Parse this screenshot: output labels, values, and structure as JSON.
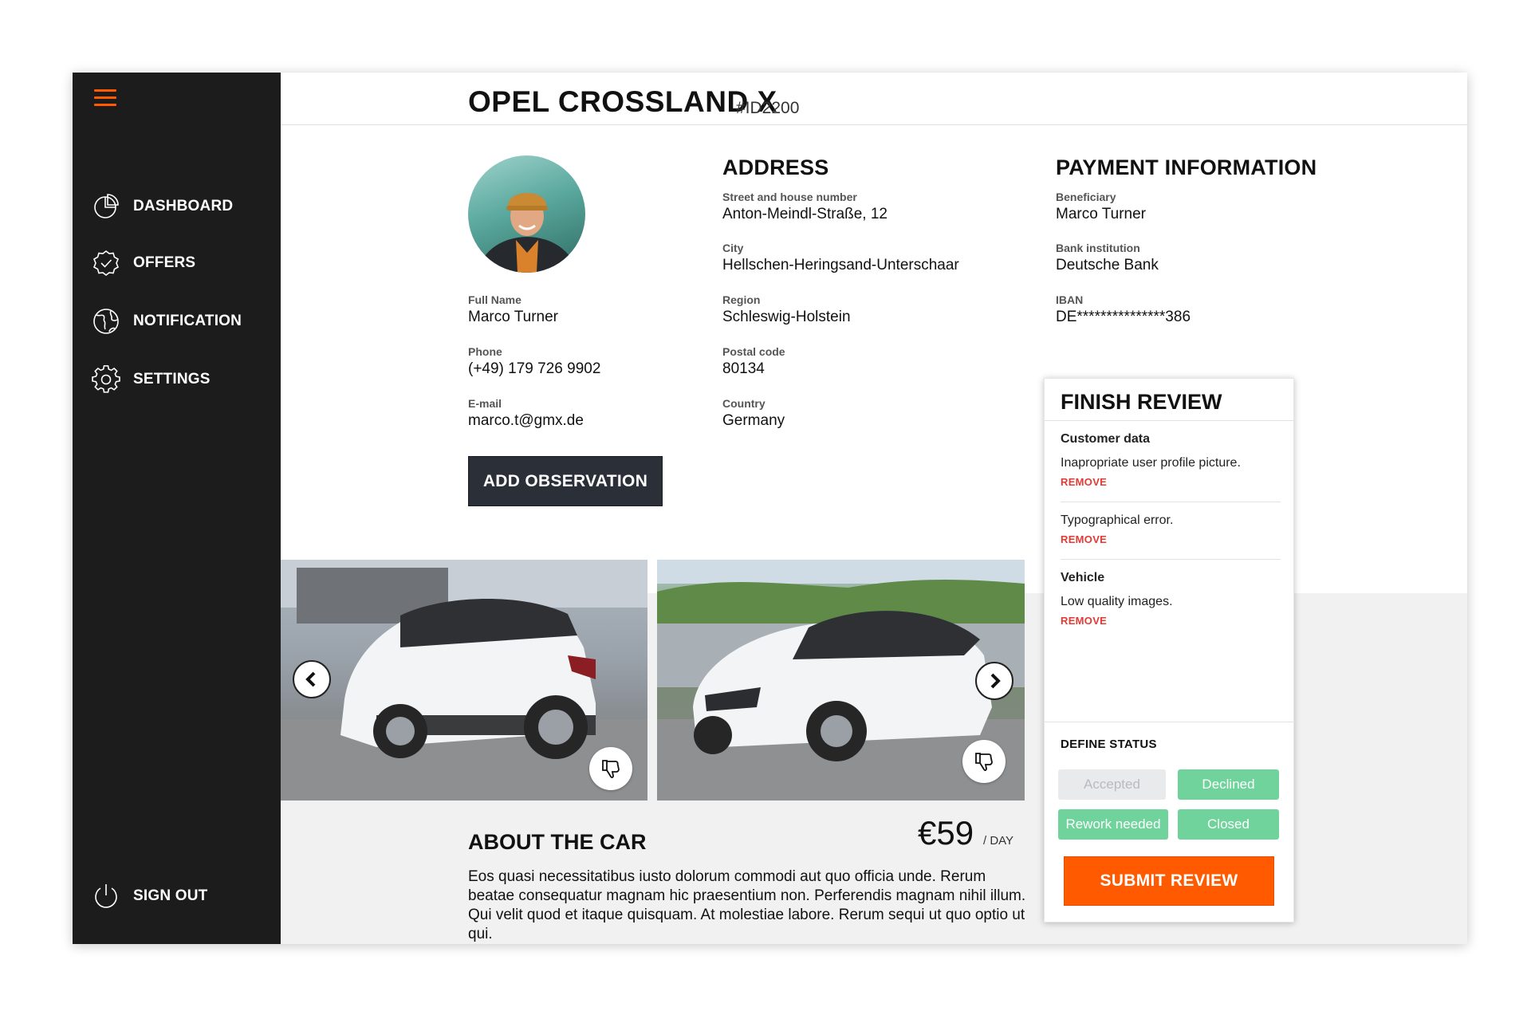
{
  "colors": {
    "accent": "#ff5a00",
    "sidebar_bg": "#1c1c1c",
    "status_green": "#6fd39b",
    "status_disabled": "#e9eaec",
    "remove_red": "#e53935",
    "dark_button": "#2b2f38"
  },
  "sidebar": {
    "menu_icon": "hamburger-icon",
    "items": [
      {
        "label": "DASHBOARD",
        "icon": "pie-chart-icon"
      },
      {
        "label": "OFFERS",
        "icon": "badge-check-icon"
      },
      {
        "label": "NOTIFICATION",
        "icon": "globe-icon"
      },
      {
        "label": "SETTINGS",
        "icon": "gear-icon"
      }
    ],
    "sign_out": {
      "label": "SIGN OUT",
      "icon": "power-icon"
    }
  },
  "header": {
    "title": "OPEL CROSSLAND X",
    "id": "#ID2200"
  },
  "profile": {
    "full_name_label": "Full Name",
    "full_name": "Marco Turner",
    "phone_label": "Phone",
    "phone": "(+49) 179 726 9902",
    "email_label": "E-mail",
    "email": "marco.t@gmx.de",
    "add_observation": "ADD OBSERVATION"
  },
  "address": {
    "heading": "ADDRESS",
    "street_label": "Street and house number",
    "street": "Anton-Meindl-Straße, 12",
    "city_label": "City",
    "city": "Hellschen-Heringsand-Unterschaar",
    "region_label": "Region",
    "region": "Schleswig-Holstein",
    "postal_label": "Postal code",
    "postal": "80134",
    "country_label": "Country",
    "country": "Germany"
  },
  "payment": {
    "heading": "PAYMENT INFORMATION",
    "beneficiary_label": "Beneficiary",
    "beneficiary": "Marco Turner",
    "bank_label": "Bank institution",
    "bank": "Deutsche Bank",
    "iban_label": "IBAN",
    "iban": "DE***************386"
  },
  "gallery": {
    "prev_icon": "chevron-left-icon",
    "next_icon": "chevron-right-icon",
    "dislike_icon": "thumbs-down-icon"
  },
  "about": {
    "heading": "ABOUT THE CAR",
    "price": "€59",
    "per": "/ DAY",
    "text": "Eos quasi necessitatibus iusto dolorum commodi aut quo officia unde. Rerum beatae consequatur magnam hic praesentium non. Perferendis magnam nihil illum. Qui velit quod et itaque quisquam. At molestiae labore. Rerum sequi ut quo optio ut qui."
  },
  "review": {
    "heading": "FINISH REVIEW",
    "remove_label": "REMOVE",
    "groups": [
      {
        "category": "Customer data",
        "items": [
          "Inapropriate user profile picture.",
          "Typographical error."
        ]
      },
      {
        "category": "Vehicle",
        "items": [
          "Low quality images."
        ]
      }
    ],
    "status_heading": "DEFINE STATUS",
    "statuses": [
      "Accepted",
      "Declined",
      "Rework needed",
      "Closed"
    ],
    "submit": "SUBMIT REVIEW"
  }
}
